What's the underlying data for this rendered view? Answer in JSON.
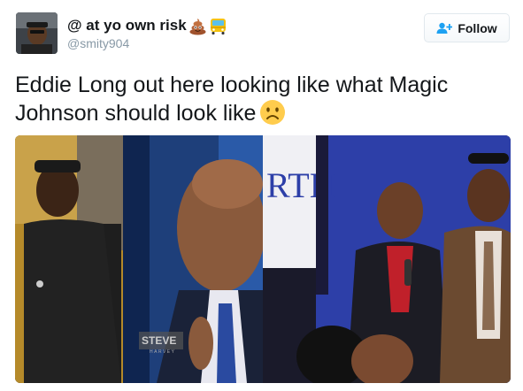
{
  "tweet": {
    "display_name": "@ at yo own risk",
    "handle": "@smity904",
    "name_emojis": [
      "pile-of-poo-emoji",
      "bus-emoji"
    ],
    "text_line1": "Eddie Long out here looking like what Magic",
    "text_line2": "Johnson should look like",
    "text_emoji": "frowning-face-emoji",
    "follow_label": "Follow"
  },
  "media": {
    "photo_sign_text": "RTH",
    "logo_text": "STEVE",
    "logo_subtext": "HARVEY"
  },
  "colors": {
    "follow_icon": "#1da1f2",
    "text_primary": "#14171a",
    "text_secondary": "#8899a6",
    "border": "#e1e8ed"
  }
}
